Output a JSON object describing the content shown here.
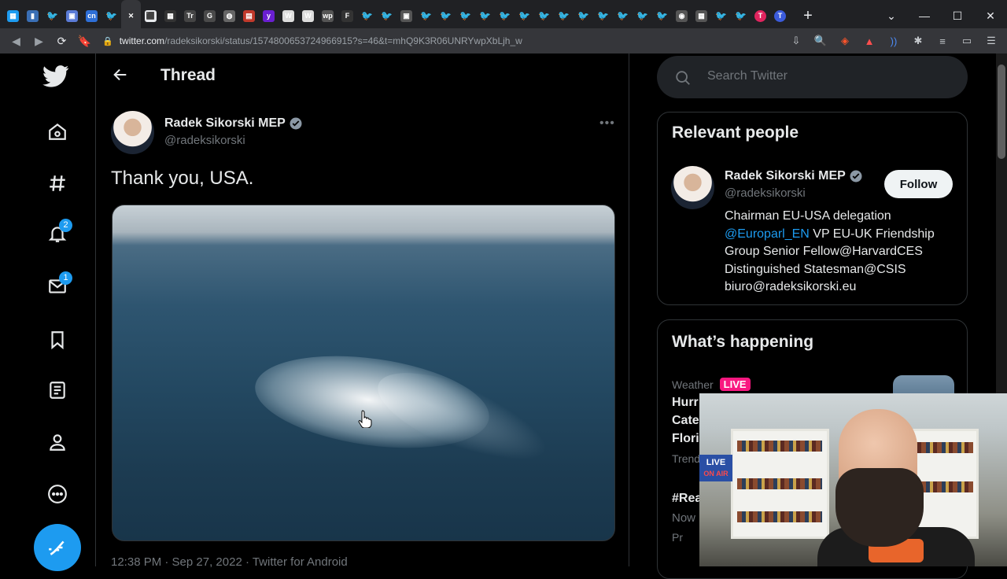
{
  "browser": {
    "url_host": "twitter.com",
    "url_path": "/radeksikorski/status/1574800653724966915?s=46&t=mhQ9K3R06UNRYwpXbLjh_w",
    "tabs": [
      "▦",
      "▮",
      "🐦",
      "▣",
      "cn",
      "🐦",
      "✕",
      "⬛",
      "▦",
      "Tr",
      "G",
      "◍",
      "▤",
      "y",
      "W",
      "W",
      "wp",
      "F",
      "🐦",
      "🐦",
      "▣",
      "🐦",
      "🐦",
      "🐦",
      "🐦",
      "🐦",
      "🐦",
      "🐦",
      "🐦",
      "🐦",
      "🐦",
      "🐦",
      "🐦",
      "🐦",
      "◉",
      "▦",
      "🐦",
      "🐦",
      "T",
      "T"
    ],
    "new_tab": "+"
  },
  "sidebar": {
    "badges": {
      "notifications": "2",
      "messages": "1"
    }
  },
  "main": {
    "header_title": "Thread",
    "author_name": "Radek Sikorski MEP",
    "author_handle": "@radeksikorski",
    "tweet_text": "Thank you, USA.",
    "meta": "12:38 PM · Sep 27, 2022 · Twitter for Android"
  },
  "right": {
    "search_placeholder": "Search Twitter",
    "relevant_title": "Relevant people",
    "person_name": "Radek Sikorski MEP",
    "person_handle": "@radeksikorski",
    "follow_label": "Follow",
    "bio_line1": "Chairman EU-USA delegation",
    "bio_link": "@Europarl_EN",
    "bio_line2_rest": " VP EU-UK Friendship",
    "bio_line3": "Group Senior Fellow@HarvardCES",
    "bio_line4": "Distinguished Statesman@CSIS",
    "bio_line5": "biuro@radeksikorski.eu",
    "happening_title": "What’s happening",
    "trend_category": "Weather",
    "live_badge": "LIVE",
    "trend_line1": "Hurr",
    "trend_line2": "Cate",
    "trend_line3": "Flori",
    "trend_sub1": "Trend",
    "trend_line4": "#Rea",
    "trend_sub2": "Now",
    "trend_sub3": "Pr"
  },
  "webcam": {
    "sign_line1": "LIVE",
    "sign_line2": "ON AIR"
  },
  "colors": {
    "accent": "#1d9bf0",
    "live": "#f91880",
    "background": "#000000"
  }
}
